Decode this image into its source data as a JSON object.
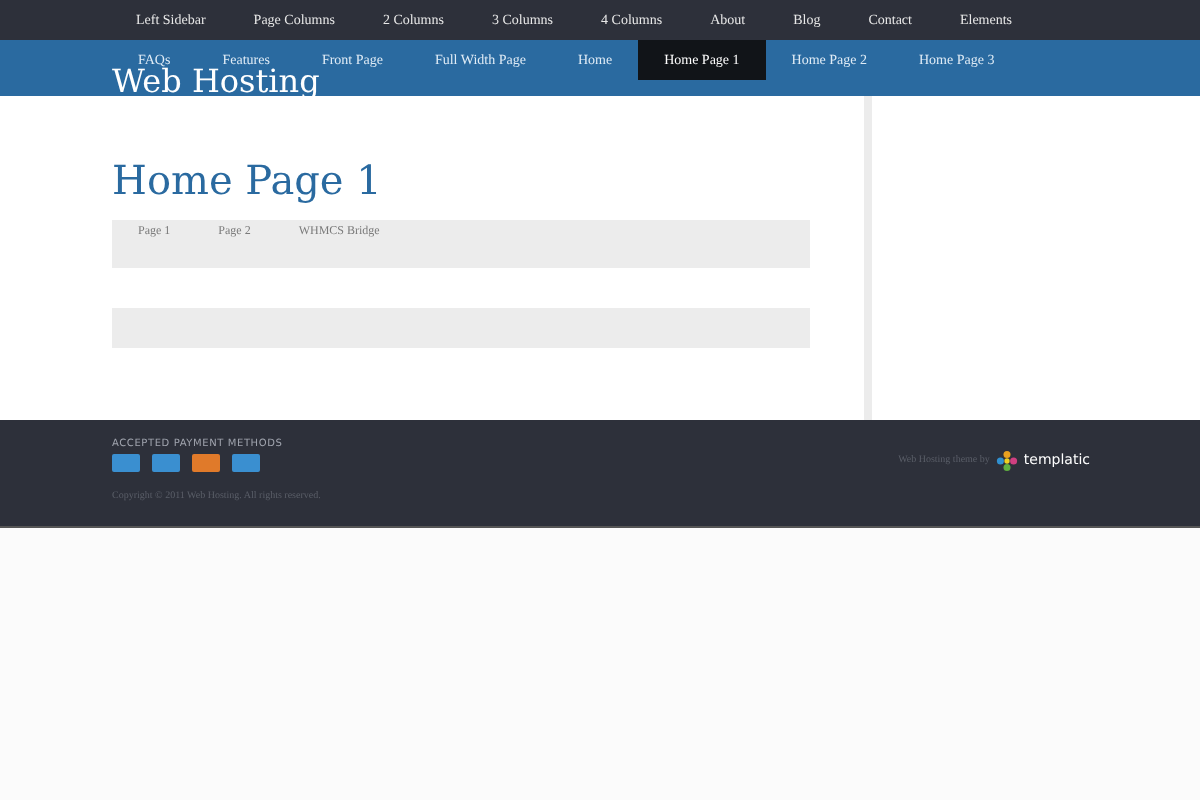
{
  "top_menu": [
    {
      "label": "Left Sidebar"
    },
    {
      "label": "Page Columns"
    },
    {
      "label": "2 Columns"
    },
    {
      "label": "3 Columns"
    },
    {
      "label": "4 Columns"
    },
    {
      "label": "About"
    },
    {
      "label": "Blog"
    },
    {
      "label": "Contact"
    },
    {
      "label": "Elements"
    }
  ],
  "main_menu": [
    {
      "label": "FAQs",
      "selected": false
    },
    {
      "label": "Features",
      "selected": false
    },
    {
      "label": "Front Page",
      "selected": false
    },
    {
      "label": "Full Width Page",
      "selected": false
    },
    {
      "label": "Home",
      "selected": false
    },
    {
      "label": "Home Page 1",
      "selected": true
    },
    {
      "label": "Home Page 2",
      "selected": false
    },
    {
      "label": "Home Page 3",
      "selected": false
    }
  ],
  "site_title": "Web Hosting",
  "page_title": "Home Page 1",
  "table": {
    "columns": [
      "Page 1",
      "Page 2",
      "WHMCS Bridge"
    ]
  },
  "footer": {
    "payment_heading": "ACCEPTED PAYMENT METHODS",
    "cards": [
      {
        "color": "#3a8fd0"
      },
      {
        "color": "#3a8fd0"
      },
      {
        "color": "#e07a2a"
      },
      {
        "color": "#3a8fd0"
      }
    ],
    "copyright": "Copyright © 2011 Web Hosting. All rights reserved.",
    "credit": "Web Hosting theme by",
    "brand": "templatic"
  }
}
